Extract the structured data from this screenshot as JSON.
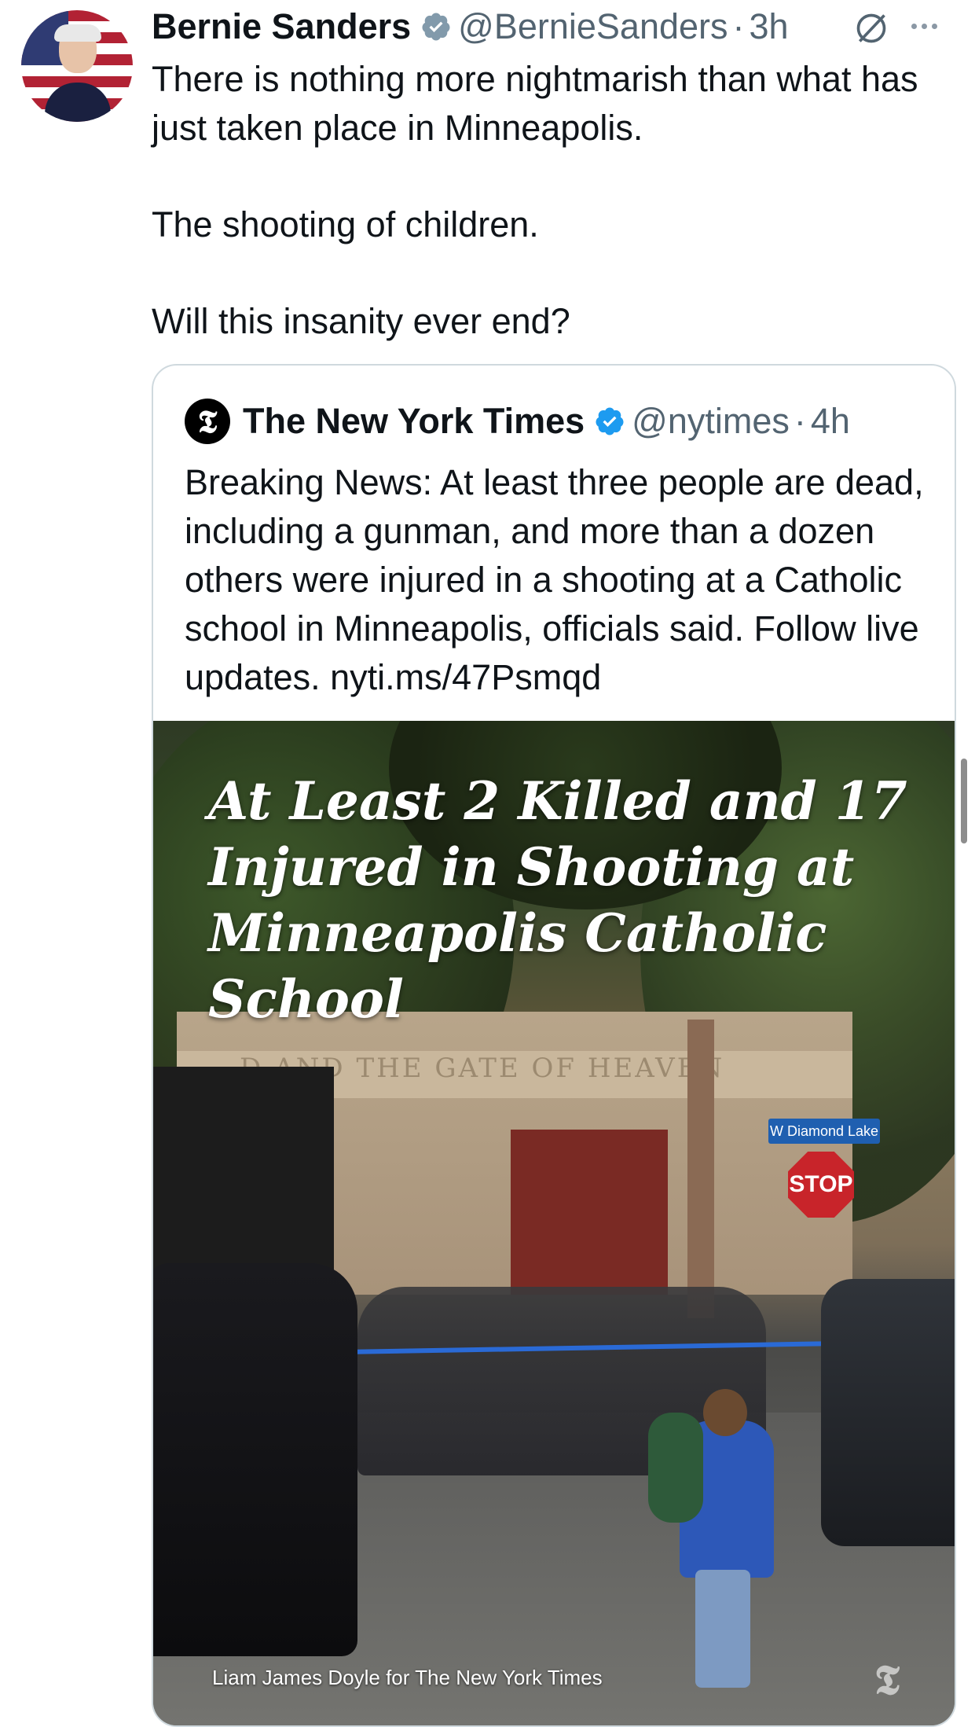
{
  "author": {
    "name": "Bernie Sanders",
    "handle": "@BernieSanders",
    "separator": "·",
    "time": "3h"
  },
  "icons": {
    "verified": "verified-badge-icon",
    "grok": "grok-icon",
    "more": "more-options-icon",
    "accent_color": "#1d9bf0"
  },
  "tweet": {
    "paragraphs": [
      "There is nothing more nightmarish than what has just taken place in Minneapolis.",
      "The shooting of children.",
      "Will this insanity ever end?"
    ]
  },
  "quote": {
    "logo_glyph": "𝕿",
    "name": "The New York Times",
    "handle": "@nytimes",
    "separator": "·",
    "time": "4h",
    "text": "Breaking News: At least three people are dead, including a gunman, and more than a dozen others were injured in a shooting at a Catholic school in Minneapolis, officials said. Follow live updates. nyti.ms/47Psmqd",
    "image": {
      "headline": "At Least 2 Killed and 17 Injured in Shooting at Minneapolis Catholic School",
      "building_inscription": "D AND THE GATE OF HEAVEN",
      "street_sign": "W Diamond Lake",
      "stop_sign": "STOP",
      "credit": "Liam James Doyle for The New York Times",
      "watermark": "𝕿"
    }
  }
}
